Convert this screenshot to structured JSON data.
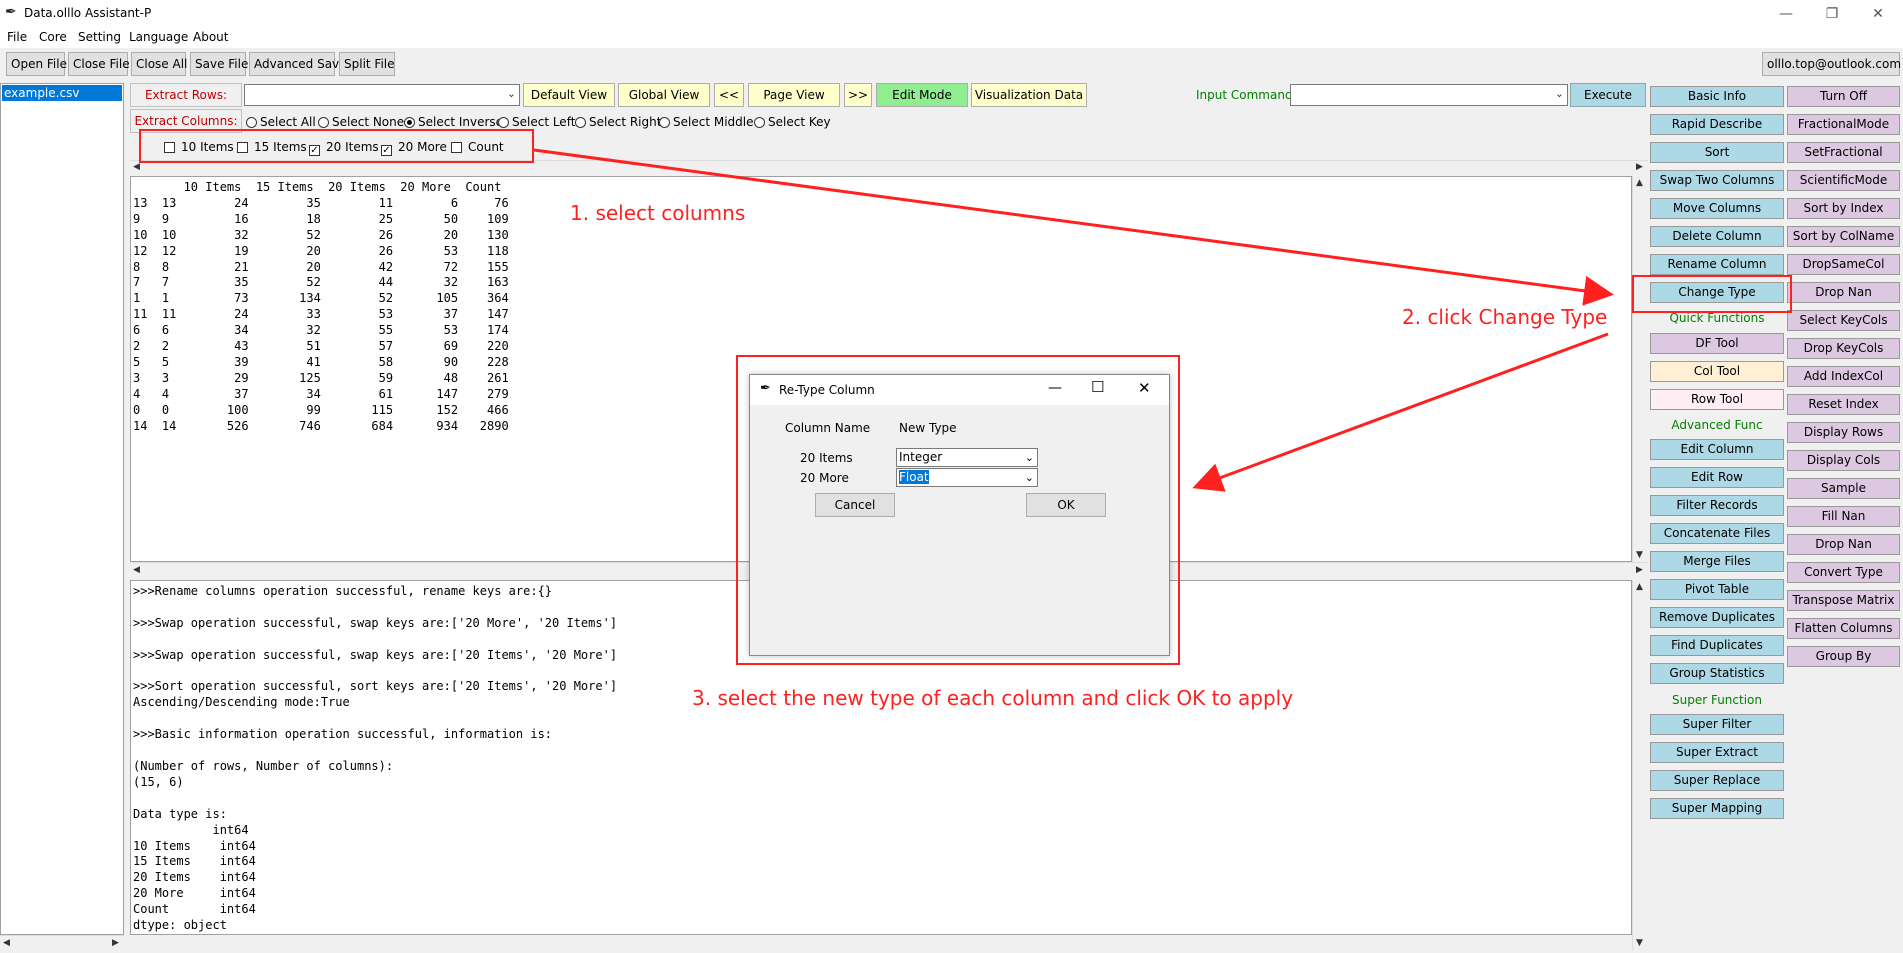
{
  "window": {
    "title": "Data.olllo Assistant-P"
  },
  "menu": [
    "File",
    "Core",
    "Setting",
    "Language",
    "About"
  ],
  "toolbar": [
    "Open File",
    "Close File",
    "Close All",
    "Save File",
    "Advanced Save",
    "Split File"
  ],
  "account": "olllo.top@outlook.com",
  "files": [
    "example.csv"
  ],
  "extract": {
    "rows_label": "Extract Rows:",
    "cols_label": "Extract Columns:",
    "view_buttons": [
      "Default View",
      "Global View",
      "<<",
      "Page View",
      ">>"
    ],
    "edit_mode": "Edit Mode",
    "vis_data": "Visualization Data",
    "input_command": "Input Command:",
    "execute": "Execute",
    "radios": [
      "Select All",
      "Select None",
      "Select Inverse",
      "Select Left",
      "Select Right",
      "Select Middle",
      "Select Key"
    ],
    "radio_selected": "Select Inverse",
    "checks": [
      {
        "label": "10 Items",
        "checked": false
      },
      {
        "label": "15 Items",
        "checked": false
      },
      {
        "label": "20 Items",
        "checked": true
      },
      {
        "label": "20 More",
        "checked": true
      },
      {
        "label": "Count",
        "checked": false
      }
    ]
  },
  "table": {
    "header": "       10 Items  15 Items  20 Items  20 More  Count",
    "rows": [
      "13  13        24        35        11        6     76",
      "9   9         16        18        25       50    109",
      "10  10        32        52        26       20    130",
      "12  12        19        20        26       53    118",
      "8   8         21        20        42       72    155",
      "7   7         35        52        44       32    163",
      "1   1         73       134        52      105    364",
      "11  11        24        33        53       37    147",
      "6   6         34        32        55       53    174",
      "2   2         43        51        57       69    220",
      "5   5         39        41        58       90    228",
      "3   3         29       125        59       48    261",
      "4   4         37        34        61      147    279",
      "0   0        100        99       115      152    466",
      "14  14       526       746       684      934   2890"
    ]
  },
  "log": [
    ">>>Rename columns operation successful, rename keys are:{}",
    "",
    ">>>Swap operation successful, swap keys are:['20 More', '20 Items']",
    "",
    ">>>Swap operation successful, swap keys are:['20 Items', '20 More']",
    "",
    ">>>Sort operation successful, sort keys are:['20 Items', '20 More']",
    "Ascending/Descending mode:True",
    "",
    ">>>Basic information operation successful, information is:",
    "",
    "(Number of rows, Number of columns):",
    "(15, 6)",
    "",
    "Data type is:",
    "           int64",
    "10 Items    int64",
    "15 Items    int64",
    "20 Items    int64",
    "20 More     int64",
    "Count       int64",
    "dtype: object"
  ],
  "right_col1": {
    "top": [
      "Basic Info",
      "Rapid Describe",
      "Sort",
      "Swap Two Columns",
      "Move Columns",
      "Delete Column",
      "Rename Column",
      "Change Type"
    ],
    "quick_label": "Quick Functions",
    "quick": [
      "DF Tool",
      "Col Tool",
      "Row Tool"
    ],
    "adv_label": "Advanced Func",
    "adv": [
      "Edit Column",
      "Edit Row",
      "Filter Records",
      "Concatenate Files",
      "Merge Files",
      "Pivot Table",
      "Remove Duplicates",
      "Find Duplicates",
      "Group Statistics"
    ],
    "super_label": "Super Function",
    "super": [
      "Super Filter",
      "Super Extract",
      "Super Replace",
      "Super Mapping"
    ]
  },
  "right_col2": [
    "Turn Off",
    "FractionalMode",
    "SetFractional",
    "ScientificMode",
    "Sort by Index",
    "Sort by ColName",
    "DropSameCol",
    "Drop Nan",
    "Select KeyCols",
    "Drop KeyCols",
    "Add IndexCol",
    "Reset Index",
    "Display Rows",
    "Display Cols",
    "Sample",
    "Fill Nan",
    "Drop Nan",
    "Convert Type",
    "Transpose Matrix",
    "Flatten Columns",
    "Group By"
  ],
  "annotations": {
    "step1": "1. select columns",
    "step2": "2. click Change Type",
    "step3": "3. select the new type of each column and click OK to apply"
  },
  "dialog": {
    "title": "Re-Type Column",
    "col_header": "Column Name",
    "type_header": "New Type",
    "rows": [
      {
        "name": "20 Items",
        "type": "Integer"
      },
      {
        "name": "20 More",
        "type": "Float"
      }
    ],
    "cancel": "Cancel",
    "ok": "OK"
  },
  "colors": {
    "annotation": "#ff2020",
    "blue_btn": "#add8e6",
    "violet_btn": "#dcc8e0",
    "green_btn": "#90ee90",
    "yellow_btn": "#ffffcc"
  }
}
